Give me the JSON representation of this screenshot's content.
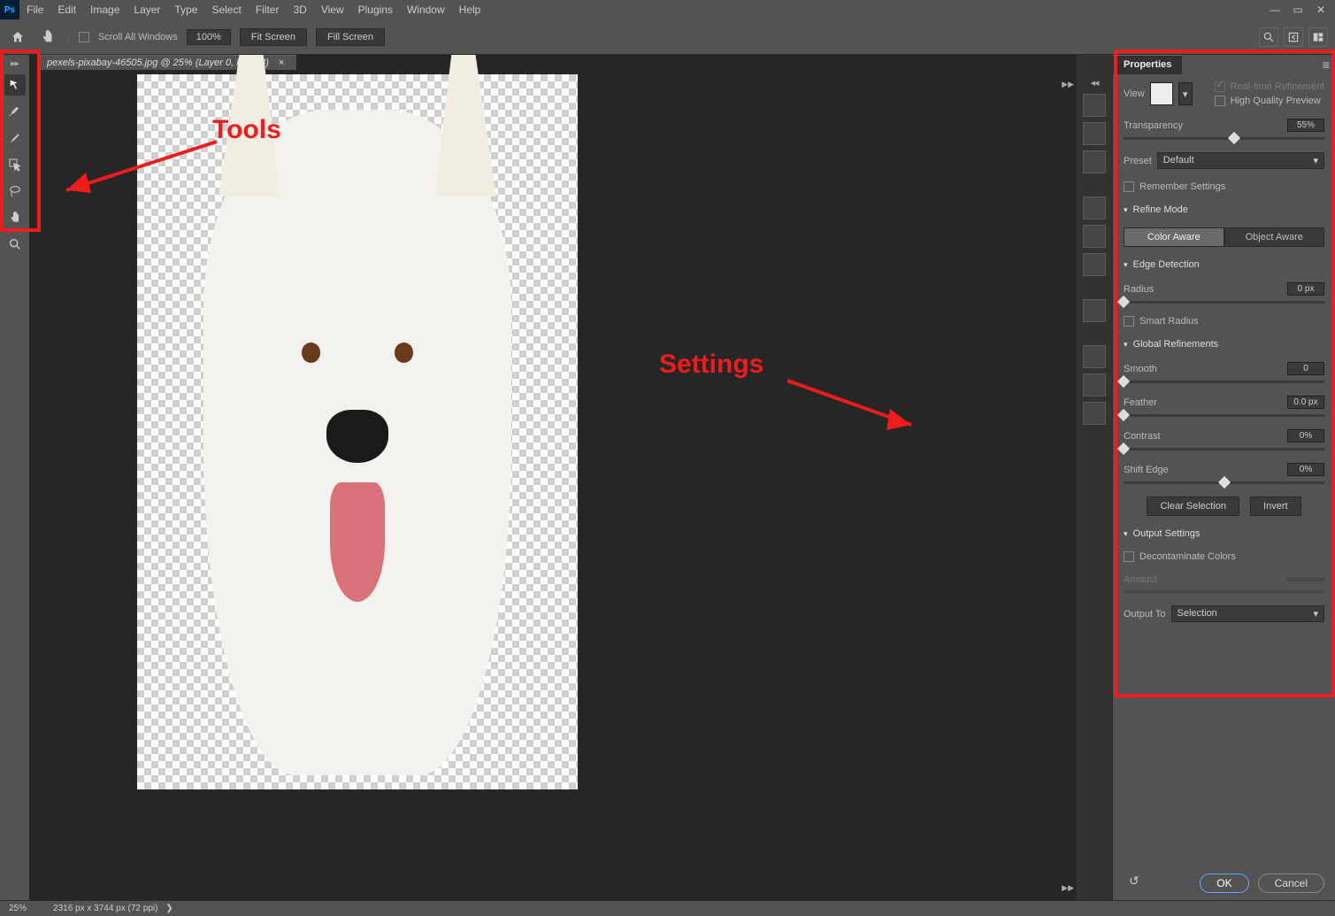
{
  "app": {
    "logo": "Ps"
  },
  "menu": [
    "File",
    "Edit",
    "Image",
    "Layer",
    "Type",
    "Select",
    "Filter",
    "3D",
    "View",
    "Plugins",
    "Window",
    "Help"
  ],
  "optbar": {
    "scroll_all": "Scroll All Windows",
    "zoom": "100%",
    "fit": "Fit Screen",
    "fill": "Fill Screen"
  },
  "doctab": {
    "title": "pexels-pixabay-46505.jpg @ 25% (Layer 0, RGB/8)"
  },
  "annotations": {
    "tools": "Tools",
    "settings": "Settings"
  },
  "panel": {
    "title": "Properties",
    "view_label": "View",
    "realtime": "Real-time Refinement",
    "hq_preview": "High Quality Preview",
    "transparency": {
      "label": "Transparency",
      "value": "55%",
      "pct": 55
    },
    "preset_label": "Preset",
    "preset_value": "Default",
    "remember": "Remember Settings",
    "refine_mode": "Refine Mode",
    "color_aware": "Color Aware",
    "object_aware": "Object Aware",
    "edge_detection": "Edge Detection",
    "radius": {
      "label": "Radius",
      "value": "0 px",
      "pct": 0
    },
    "smart_radius": "Smart Radius",
    "global_refinements": "Global Refinements",
    "smooth": {
      "label": "Smooth",
      "value": "0",
      "pct": 0
    },
    "feather": {
      "label": "Feather",
      "value": "0.0 px",
      "pct": 0
    },
    "contrast": {
      "label": "Contrast",
      "value": "0%",
      "pct": 0
    },
    "shift_edge": {
      "label": "Shift Edge",
      "value": "0%",
      "pct": 50
    },
    "clear_selection": "Clear Selection",
    "invert": "Invert",
    "output_settings": "Output Settings",
    "decontaminate": "Decontaminate Colors",
    "amount": "Amount",
    "output_to_label": "Output To",
    "output_to_value": "Selection",
    "ok": "OK",
    "cancel": "Cancel"
  },
  "statusbar": {
    "zoom": "25%",
    "dims": "2316 px x 3744 px (72 ppi)"
  }
}
